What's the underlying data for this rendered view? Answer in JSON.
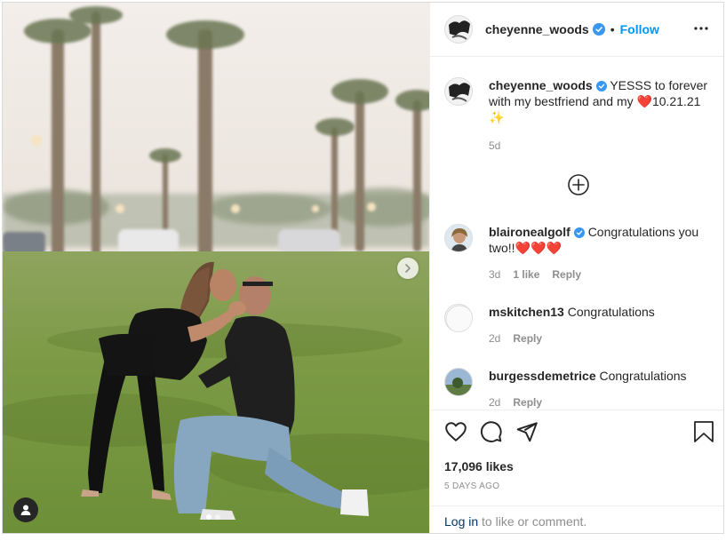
{
  "header": {
    "username": "cheyenne_woods",
    "separator": "•",
    "follow_label": "Follow"
  },
  "caption": {
    "username": "cheyenne_woods",
    "text_before": "YESSS to forever with my bestfriend and my ",
    "heart": "❤️",
    "text_after": "10.21.21 ",
    "sparkles": "✨",
    "time": "5d"
  },
  "comments": [
    {
      "username": "blaironealgolf",
      "verified": true,
      "text": "Congratulations you two!!",
      "emoji": "❤️❤️❤️",
      "time": "3d",
      "likes": "1 like",
      "reply": "Reply"
    },
    {
      "username": "mskitchen13",
      "verified": false,
      "text": "Congratulations",
      "emoji": "",
      "time": "2d",
      "likes": "",
      "reply": "Reply"
    },
    {
      "username": "burgessdemetrice",
      "verified": false,
      "text": "Congratulations",
      "emoji": "",
      "time": "2d",
      "likes": "",
      "reply": "Reply"
    }
  ],
  "actions": {
    "likes": "17,096 likes",
    "posted": "5 DAYS AGO"
  },
  "login": {
    "link": "Log in",
    "rest": " to like or comment."
  },
  "colors": {
    "accent": "#0095f6",
    "heart": "#ed1c24",
    "verified": "#3897f0"
  },
  "icons": [
    "verified-badge-icon",
    "more-options-icon",
    "add-comment-icon",
    "heart-icon",
    "comment-icon",
    "share-icon",
    "bookmark-icon",
    "next-arrow-icon",
    "user-tag-icon"
  ],
  "carousel": {
    "count": 2,
    "active": 1
  }
}
